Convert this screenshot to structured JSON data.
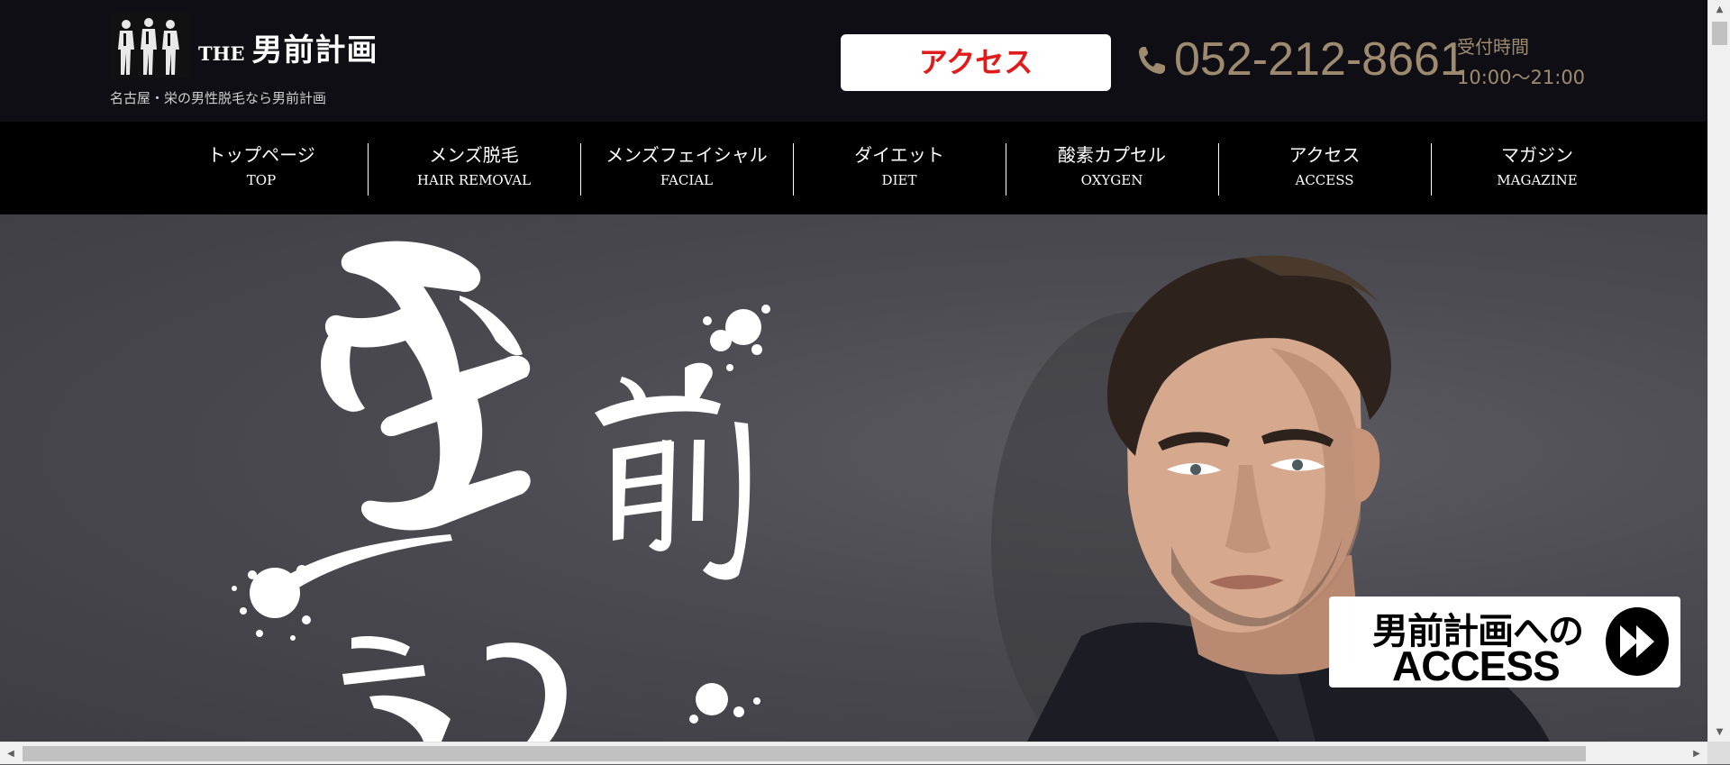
{
  "header": {
    "logo_alt": "logo-image",
    "logo_prefix": "THE",
    "logo_name": "男前計画",
    "tagline": "名古屋・栄の男性脱毛なら男前計画",
    "access_button": "アクセス",
    "phone_number": "052-212-8661",
    "hours_label": "受付時間",
    "hours_value": "10:00～21:00"
  },
  "nav": {
    "items": [
      {
        "jp": "トップページ",
        "en": "TOP"
      },
      {
        "jp": "メンズ脱毛",
        "en": "HAIR REMOVAL"
      },
      {
        "jp": "メンズフェイシャル",
        "en": "FACIAL"
      },
      {
        "jp": "ダイエット",
        "en": "DIET"
      },
      {
        "jp": "酸素カプセル",
        "en": "OXYGEN"
      },
      {
        "jp": "アクセス",
        "en": "ACCESS"
      },
      {
        "jp": "マガジン",
        "en": "MAGAZINE"
      }
    ]
  },
  "hero": {
    "calligraphy_text": "男前計画",
    "banner_line1": "男前計画への",
    "banner_line2": "ACCESS"
  },
  "colors": {
    "header_bg": "#0f0e15",
    "nav_bg": "#000000",
    "accent_red": "#e01b1b",
    "gold": "#9e8b6f"
  },
  "icons": {
    "phone": "phone-icon",
    "banner_arrow": "play-arrow-icon"
  }
}
